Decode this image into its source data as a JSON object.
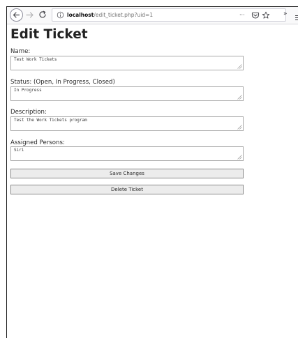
{
  "browser": {
    "url_host": "localhost",
    "url_path": "/edit_ticket.php?uid=1",
    "page_actions_label": "···",
    "overflow_label": "»"
  },
  "page": {
    "title": "Edit Ticket",
    "fields": [
      {
        "label": "Name:",
        "value": "Test Work Tickets"
      },
      {
        "label": "Status: (Open, In Progress, Closed)",
        "value": "In Progress"
      },
      {
        "label": "Description:",
        "value": "Test the Work Tickets program"
      },
      {
        "label": "Assigned Persons:",
        "value": "Siri"
      }
    ],
    "save_label": "Save Changes",
    "delete_label": "Delete Ticket"
  },
  "colors": {
    "page_background": "#ffffff",
    "toolbar_background": "#f9f9fa",
    "button_background": "#ececec"
  }
}
